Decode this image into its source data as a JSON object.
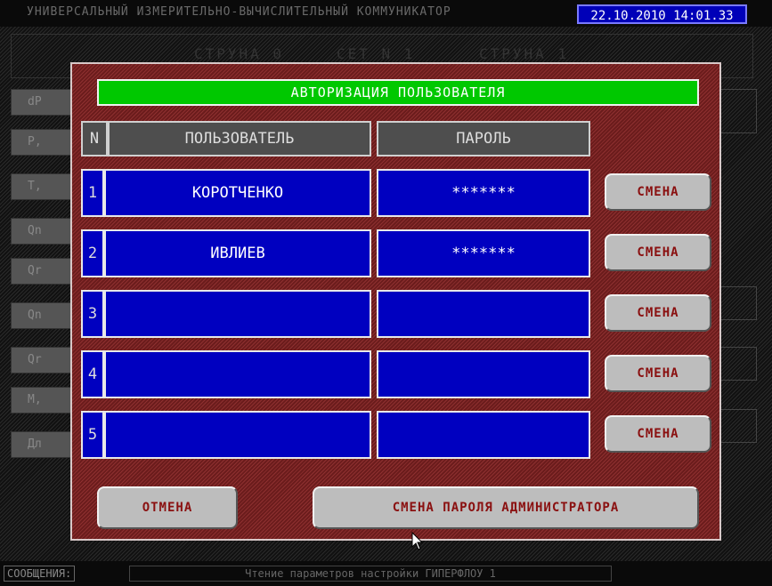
{
  "app": {
    "title": "УНИВЕРСАЛЬНЫЙ ИЗМЕРИТЕЛЬНО-ВЫЧИСЛИТЕЛЬНЫЙ КОММУНИКАТОР",
    "datetime": "22.10.2010 14:01.33"
  },
  "background": {
    "header": [
      "СТРУНА 0",
      "СЕТ N 1",
      "СТРУНА 1"
    ],
    "rows": [
      "dP",
      "P,",
      "T,",
      "Qn",
      "Qr",
      "Qn",
      "Qr",
      "M,",
      "Дл"
    ]
  },
  "dialog": {
    "title": "АВТОРИЗАЦИЯ ПОЛЬЗОВАТЕЛЯ",
    "columns": {
      "n": "N",
      "user": "ПОЛЬЗОВАТЕЛЬ",
      "password": "ПАРОЛЬ"
    },
    "rows": [
      {
        "n": "1",
        "user": "КОРОТЧЕНКО",
        "password": "*******",
        "action": "СМЕНА"
      },
      {
        "n": "2",
        "user": "ИВЛИЕВ",
        "password": "*******",
        "action": "СМЕНА"
      },
      {
        "n": "3",
        "user": "",
        "password": "",
        "action": "СМЕНА"
      },
      {
        "n": "4",
        "user": "",
        "password": "",
        "action": "СМЕНА"
      },
      {
        "n": "5",
        "user": "",
        "password": "",
        "action": "СМЕНА"
      }
    ],
    "cancel_label": "ОТМЕНА",
    "admin_password_label": "СМЕНА ПАРОЛЯ АДМИНИСТРАТОРА"
  },
  "status_bar": {
    "label": "СООБЩЕНИЯ:",
    "message": "Чтение параметров настройки ГИПЕРФЛОУ 1"
  },
  "colors": {
    "dialog_title_bg": "#00c800",
    "cell_bg": "#0000c0",
    "button_text": "#8a1010",
    "datetime_bg": "#0000b8"
  }
}
